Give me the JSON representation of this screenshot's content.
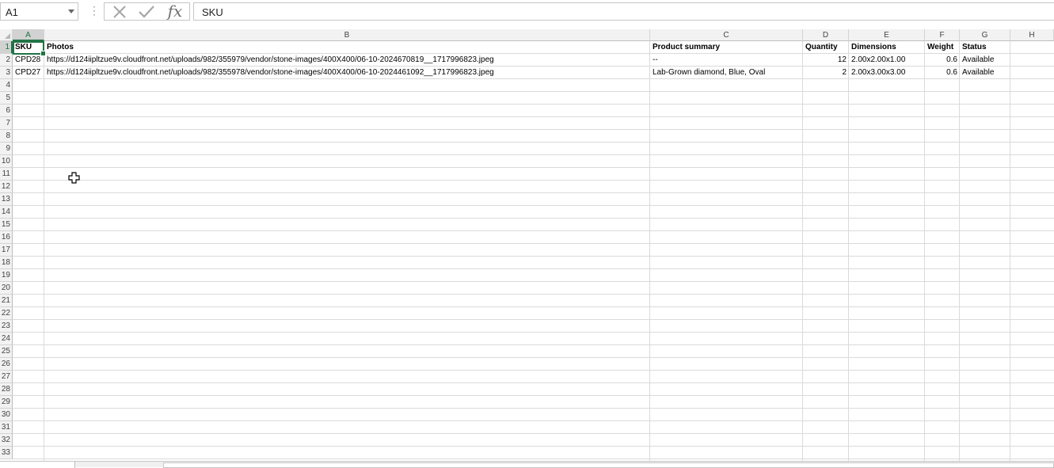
{
  "formula_bar": {
    "name_box": "A1",
    "content": "SKU"
  },
  "columns": [
    "A",
    "B",
    "C",
    "D",
    "E",
    "F",
    "G",
    "H"
  ],
  "rows": [
    "1",
    "2",
    "3",
    "4",
    "5",
    "6",
    "7",
    "8",
    "9",
    "10",
    "11",
    "12",
    "13",
    "14",
    "15",
    "16",
    "17",
    "18",
    "19",
    "20",
    "21",
    "22",
    "23",
    "24",
    "25",
    "26",
    "27",
    "28",
    "29",
    "30",
    "31",
    "32",
    "33"
  ],
  "headers": {
    "sku": "SKU",
    "photos": "Photos",
    "summary": "Product summary",
    "quantity": "Quantity",
    "dimensions": "Dimensions",
    "weight": "Weight",
    "status": "Status"
  },
  "data_rows": [
    {
      "sku": "CPD28",
      "photos": "https://d124iipltzue9v.cloudfront.net/uploads/982/355979/vendor/stone-images/400X400/06-10-2024670819__1717996823.jpeg",
      "summary": "--",
      "quantity": "12",
      "dimensions": "2.00x2.00x1.00",
      "weight": "0.6",
      "status": "Available"
    },
    {
      "sku": "CPD27",
      "photos": "https://d124iipltzue9v.cloudfront.net/uploads/982/355978/vendor/stone-images/400X400/06-10-2024461092__1717996823.jpeg",
      "summary": "Lab-Grown diamond, Blue, Oval",
      "quantity": "2",
      "dimensions": "2.00x3.00x3.00",
      "weight": "0.6",
      "status": "Available"
    }
  ],
  "colors": {
    "accent": "#217346",
    "gridline": "#dadada",
    "header_bg": "#f2f2f2"
  },
  "icons": {
    "cancel": "x-icon",
    "enter": "check-icon",
    "function": "fx-icon",
    "cursor": "cell-cross-cursor-icon"
  }
}
